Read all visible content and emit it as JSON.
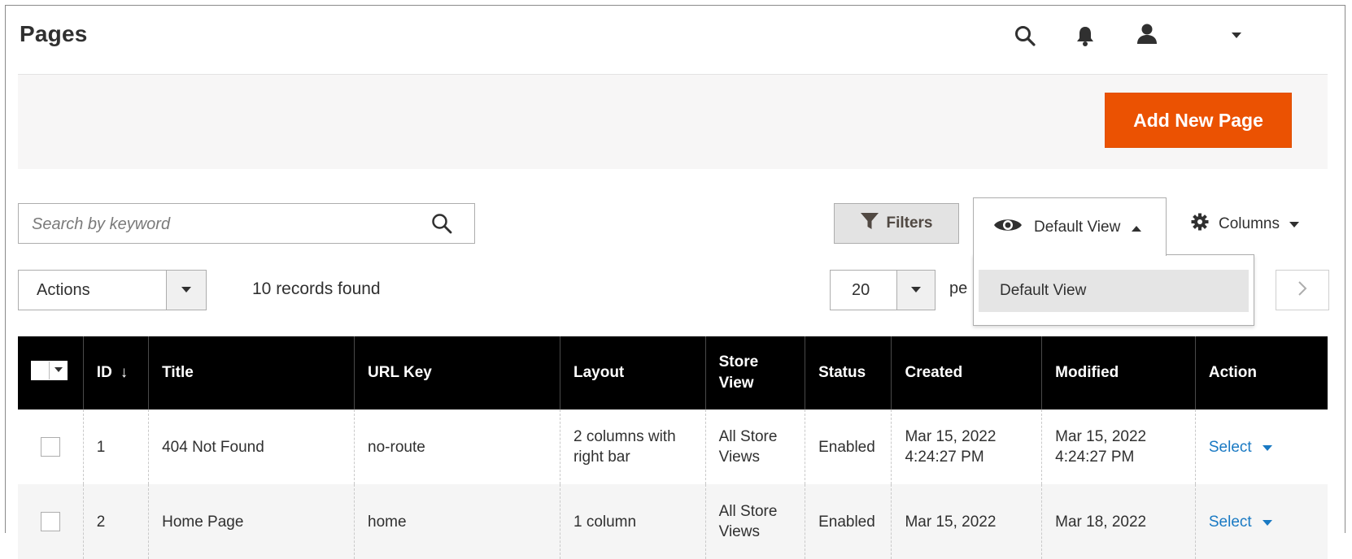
{
  "header": {
    "title": "Pages",
    "icons": [
      "search-icon",
      "bell-icon",
      "user-icon",
      "caret-down-icon"
    ]
  },
  "action_bar": {
    "add_button": "Add New Page",
    "accent": "#eb5202"
  },
  "toolbar": {
    "search_placeholder": "Search by keyword",
    "filters_label": "Filters",
    "view_label": "Default View",
    "view_options": [
      "Default View"
    ],
    "columns_label": "Columns",
    "actions_label": "Actions",
    "records_text": "10 records found",
    "per_page_value": "20",
    "per_page_label": "pe"
  },
  "table": {
    "headers": {
      "id": "ID",
      "sort_indicator": "↓",
      "title": "Title",
      "url_key": "URL Key",
      "layout": "Layout",
      "store_view_l1": "Store",
      "store_view_l2": "View",
      "status": "Status",
      "created": "Created",
      "modified": "Modified",
      "action": "Action"
    },
    "rows": [
      {
        "id": "1",
        "title": "404 Not Found",
        "url_key": "no-route",
        "layout_l1": "2 columns with",
        "layout_l2": "right bar",
        "store_l1": "All Store",
        "store_l2": "Views",
        "status": "Enabled",
        "created_l1": "Mar 15, 2022",
        "created_l2": "4:24:27 PM",
        "modified_l1": "Mar 15, 2022",
        "modified_l2": "4:24:27 PM",
        "action": "Select"
      },
      {
        "id": "2",
        "title": "Home Page",
        "url_key": "home",
        "layout_l1": "1 column",
        "layout_l2": "",
        "store_l1": "All Store",
        "store_l2": "Views",
        "status": "Enabled",
        "created_l1": "Mar 15, 2022",
        "created_l2": "",
        "modified_l1": "Mar 18, 2022",
        "modified_l2": "",
        "action": "Select"
      }
    ]
  }
}
